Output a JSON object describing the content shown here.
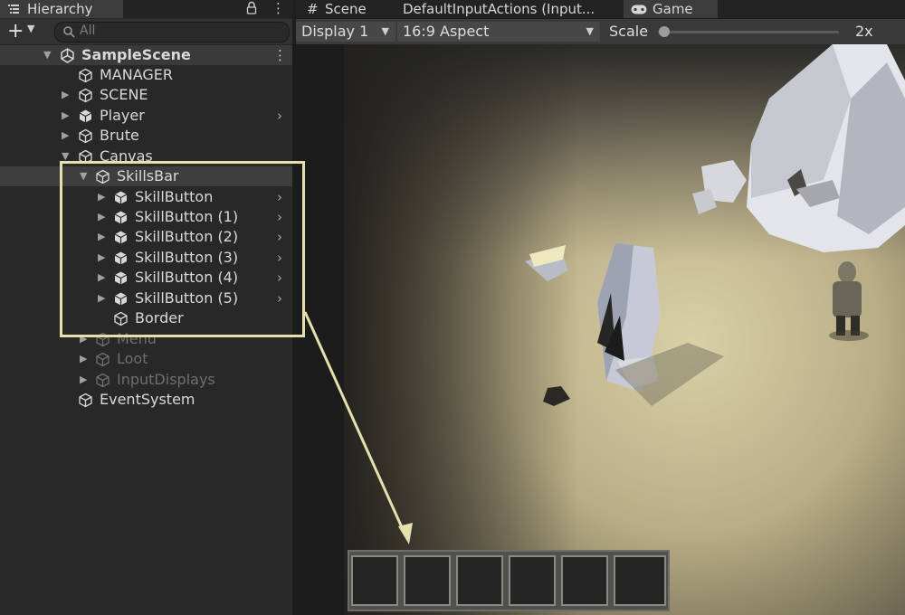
{
  "hierarchy": {
    "tab_label": "Hierarchy",
    "search_placeholder": "All",
    "rows": [
      {
        "label": "SampleScene",
        "icon": "unity-logo-icon"
      },
      {
        "label": "MANAGER",
        "icon": "gameobject-cube-icon"
      },
      {
        "label": "SCENE",
        "icon": "gameobject-cube-icon"
      },
      {
        "label": "Player",
        "icon": "prefab-cube-icon"
      },
      {
        "label": "Brute",
        "icon": "gameobject-cube-icon"
      },
      {
        "label": "Canvas",
        "icon": "gameobject-cube-icon"
      },
      {
        "label": "SkillsBar",
        "icon": "gameobject-cube-icon"
      },
      {
        "label": "SkillButton",
        "icon": "prefab-cube-icon"
      },
      {
        "label": "SkillButton (1)",
        "icon": "prefab-cube-icon"
      },
      {
        "label": "SkillButton (2)",
        "icon": "prefab-cube-icon"
      },
      {
        "label": "SkillButton (3)",
        "icon": "prefab-cube-icon"
      },
      {
        "label": "SkillButton (4)",
        "icon": "prefab-cube-icon"
      },
      {
        "label": "SkillButton (5)",
        "icon": "prefab-cube-icon"
      },
      {
        "label": "Border",
        "icon": "gameobject-cube-icon"
      },
      {
        "label": "Menu",
        "icon": "gameobject-cube-icon"
      },
      {
        "label": "Loot",
        "icon": "gameobject-cube-icon"
      },
      {
        "label": "InputDisplays",
        "icon": "gameobject-cube-icon"
      },
      {
        "label": "EventSystem",
        "icon": "gameobject-cube-icon"
      }
    ]
  },
  "tabs": {
    "scene": "Scene",
    "input_actions": "DefaultInputActions (Input...",
    "game": "Game"
  },
  "game_toolbar": {
    "display": "Display 1",
    "aspect": "16:9 Aspect",
    "scale_label": "Scale",
    "scale_value": "2x"
  },
  "skills_bar": {
    "slot_count": 6
  },
  "colors": {
    "selection_bg": "#3e3e3e",
    "annotation": "#e6dfae",
    "panel_bg": "#282828"
  }
}
